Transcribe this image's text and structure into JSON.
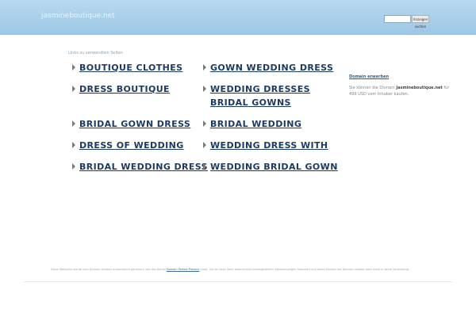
{
  "header": {
    "site_name": "jasmineboutique.net",
    "search_placeholder": "",
    "search_button": "Anzeigen suchen"
  },
  "main": {
    "links_caption": "Links zu verwandten Seiten",
    "links": [
      "BOUTIQUE CLOTHES",
      "GOWN WEDDING DRESS",
      "DRESS BOUTIQUE",
      "WEDDING DRESSES BRIDAL GOWNS",
      "BRIDAL GOWN DRESS",
      "BRIDAL WEDDING",
      "DRESS OF WEDDING",
      "WEDDING DRESS WITH",
      "BRIDAL WEDDING DRESS",
      "WEDDING BRIDAL GOWN"
    ]
  },
  "sidebar": {
    "title": "Domain erwerben",
    "text_before": "Sie können die Domain ",
    "domain": "jasmineboutique.net",
    "text_after": " für 499 USD vom Inhaber kaufen."
  },
  "footer": {
    "text_before": "Diese Webseite wurde vom Domain-Inhaber automatisch generiert, der das Dienst ",
    "link": "Domain Parked Präsenz",
    "text_after": " nutzt. Sie ist diese Seite kommerziell bereitgestellter Werbeanzeigen finanziert und bietet Nutzen mit Domain-Inhaber oder Seite in keine Verbindung."
  }
}
